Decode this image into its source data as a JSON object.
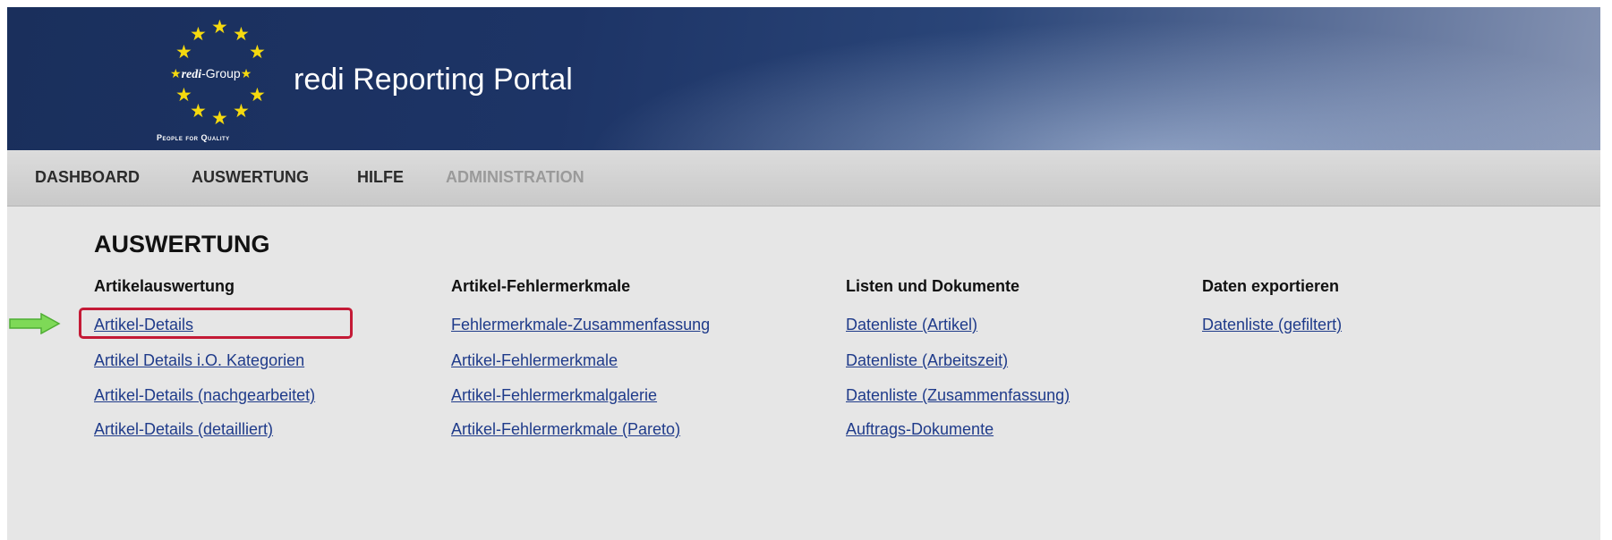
{
  "header": {
    "logo_brand_italic": "redi",
    "logo_brand_rest": "-Group",
    "tagline": "People for Quality",
    "title": "redi Reporting Portal"
  },
  "nav": {
    "items": [
      {
        "label": "DASHBOARD"
      },
      {
        "label": "AUSWERTUNG"
      },
      {
        "label": "HILFE"
      },
      {
        "label": "ADMINISTRATION",
        "disabled": true
      }
    ]
  },
  "main": {
    "heading": "AUSWERTUNG",
    "columns": [
      {
        "title": "Artikelauswertung",
        "links": [
          "Artikel-Details",
          "Artikel Details i.O. Kategorien",
          "Artikel-Details (nachgearbeitet)",
          "Artikel-Details (detailliert)"
        ]
      },
      {
        "title": "Artikel-Fehlermerkmale",
        "links": [
          "Fehlermerkmale-Zusammenfassung",
          "Artikel-Fehlermerkmale",
          "Artikel-Fehlermerkmalgalerie",
          "Artikel-Fehlermerkmale (Pareto)"
        ]
      },
      {
        "title": "Listen und Dokumente",
        "links": [
          "Datenliste (Artikel)",
          "Datenliste (Arbeitszeit)",
          "Datenliste (Zusammenfassung)",
          "Auftrags-Dokumente"
        ]
      },
      {
        "title": "Daten exportieren",
        "links": [
          "Datenliste (gefiltert)"
        ]
      }
    ]
  },
  "colors": {
    "header_bg": "#1d3466",
    "star": "#f5d90f",
    "link": "#1f3b8a",
    "highlight": "#c41a36",
    "arrow": "#7ed957"
  }
}
